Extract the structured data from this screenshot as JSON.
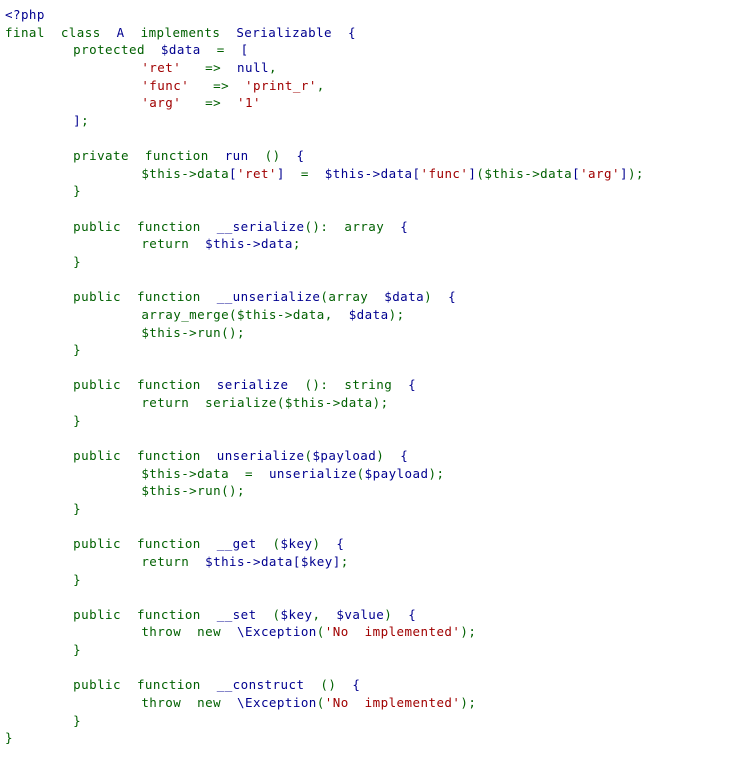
{
  "document": {
    "title": "PHP source code listing",
    "language": "php",
    "background_color": "#ffffff",
    "colors": {
      "keyword_green": "#006000",
      "identifier_blue": "#00008f",
      "string_red": "#a00000"
    },
    "lines": [
      {
        "indent": 0,
        "tokens": [
          {
            "t": "<?php",
            "c": "tag"
          }
        ]
      },
      {
        "indent": 0,
        "tokens": [
          {
            "t": "final  class  ",
            "c": "kw"
          },
          {
            "t": "A",
            "c": "name"
          },
          {
            "t": "  implements  ",
            "c": "kw"
          },
          {
            "t": "Serializable",
            "c": "name"
          },
          {
            "t": "  ",
            "c": "kw"
          },
          {
            "t": "{",
            "c": "bracket"
          }
        ]
      },
      {
        "indent": 8,
        "tokens": [
          {
            "t": "protected  ",
            "c": "kw"
          },
          {
            "t": "$data",
            "c": "var"
          },
          {
            "t": "  =  ",
            "c": "kw"
          },
          {
            "t": "[",
            "c": "bracket"
          }
        ]
      },
      {
        "indent": 16,
        "tokens": [
          {
            "t": "'ret'",
            "c": "str"
          },
          {
            "t": "   => ",
            "c": "arrow"
          },
          {
            "t": " null",
            "c": "const"
          },
          {
            "t": ",",
            "c": "punct"
          }
        ]
      },
      {
        "indent": 16,
        "tokens": [
          {
            "t": "'func'",
            "c": "str"
          },
          {
            "t": "   => ",
            "c": "arrow"
          },
          {
            "t": " ",
            "c": "punct"
          },
          {
            "t": "'print_r'",
            "c": "str"
          },
          {
            "t": ",",
            "c": "punct"
          }
        ]
      },
      {
        "indent": 16,
        "tokens": [
          {
            "t": "'arg'",
            "c": "str"
          },
          {
            "t": "   => ",
            "c": "arrow"
          },
          {
            "t": " ",
            "c": "punct"
          },
          {
            "t": "'1'",
            "c": "str"
          }
        ]
      },
      {
        "indent": 8,
        "tokens": [
          {
            "t": "]",
            "c": "bracket"
          },
          {
            "t": ";",
            "c": "punct"
          }
        ]
      },
      {
        "indent": 0,
        "tokens": []
      },
      {
        "indent": 8,
        "tokens": [
          {
            "t": "private  function  ",
            "c": "kw"
          },
          {
            "t": "run",
            "c": "name"
          },
          {
            "t": "  ()  ",
            "c": "punct"
          },
          {
            "t": "{",
            "c": "bracket"
          }
        ]
      },
      {
        "indent": 16,
        "tokens": [
          {
            "t": "$this->data",
            "c": "kw"
          },
          {
            "t": "[",
            "c": "bracket"
          },
          {
            "t": "'ret'",
            "c": "str"
          },
          {
            "t": "]",
            "c": "bracket"
          },
          {
            "t": "  =  ",
            "c": "punct"
          },
          {
            "t": "$this->data",
            "c": "name"
          },
          {
            "t": "[",
            "c": "bracket"
          },
          {
            "t": "'func'",
            "c": "str"
          },
          {
            "t": "]",
            "c": "bracket"
          },
          {
            "t": "(",
            "c": "punct"
          },
          {
            "t": "$this->data",
            "c": "kw"
          },
          {
            "t": "[",
            "c": "bracket"
          },
          {
            "t": "'arg'",
            "c": "str"
          },
          {
            "t": "]",
            "c": "bracket"
          },
          {
            "t": ");",
            "c": "punct"
          }
        ]
      },
      {
        "indent": 8,
        "tokens": [
          {
            "t": "}",
            "c": "punct"
          }
        ]
      },
      {
        "indent": 0,
        "tokens": []
      },
      {
        "indent": 8,
        "tokens": [
          {
            "t": "public  function  ",
            "c": "kw"
          },
          {
            "t": "__serialize",
            "c": "name"
          },
          {
            "t": "():  ",
            "c": "punct"
          },
          {
            "t": "array",
            "c": "kw"
          },
          {
            "t": "  ",
            "c": "kw"
          },
          {
            "t": "{",
            "c": "bracket"
          }
        ]
      },
      {
        "indent": 16,
        "tokens": [
          {
            "t": "return  ",
            "c": "kw"
          },
          {
            "t": "$this->data",
            "c": "name"
          },
          {
            "t": ";",
            "c": "punct"
          }
        ]
      },
      {
        "indent": 8,
        "tokens": [
          {
            "t": "}",
            "c": "punct"
          }
        ]
      },
      {
        "indent": 0,
        "tokens": []
      },
      {
        "indent": 8,
        "tokens": [
          {
            "t": "public  function  ",
            "c": "kw"
          },
          {
            "t": "__unserialize",
            "c": "name"
          },
          {
            "t": "(",
            "c": "punct"
          },
          {
            "t": "array",
            "c": "kw"
          },
          {
            "t": "  ",
            "c": "kw"
          },
          {
            "t": "$data",
            "c": "var"
          },
          {
            "t": ")  ",
            "c": "punct"
          },
          {
            "t": "{",
            "c": "bracket"
          }
        ]
      },
      {
        "indent": 16,
        "tokens": [
          {
            "t": "array_merge",
            "c": "kw"
          },
          {
            "t": "(",
            "c": "punct"
          },
          {
            "t": "$this->data",
            "c": "kw"
          },
          {
            "t": ",  ",
            "c": "punct"
          },
          {
            "t": "$data",
            "c": "var"
          },
          {
            "t": ");",
            "c": "punct"
          }
        ]
      },
      {
        "indent": 16,
        "tokens": [
          {
            "t": "$this->run",
            "c": "kw"
          },
          {
            "t": "();",
            "c": "punct"
          }
        ]
      },
      {
        "indent": 8,
        "tokens": [
          {
            "t": "}",
            "c": "punct"
          }
        ]
      },
      {
        "indent": 0,
        "tokens": []
      },
      {
        "indent": 8,
        "tokens": [
          {
            "t": "public  function  ",
            "c": "kw"
          },
          {
            "t": "serialize",
            "c": "name"
          },
          {
            "t": "  ():  ",
            "c": "punct"
          },
          {
            "t": "string",
            "c": "kw"
          },
          {
            "t": "  ",
            "c": "kw"
          },
          {
            "t": "{",
            "c": "bracket"
          }
        ]
      },
      {
        "indent": 16,
        "tokens": [
          {
            "t": "return  ",
            "c": "kw"
          },
          {
            "t": "serialize",
            "c": "kw"
          },
          {
            "t": "(",
            "c": "punct"
          },
          {
            "t": "$this->data",
            "c": "kw"
          },
          {
            "t": ");",
            "c": "punct"
          }
        ]
      },
      {
        "indent": 8,
        "tokens": [
          {
            "t": "}",
            "c": "punct"
          }
        ]
      },
      {
        "indent": 0,
        "tokens": []
      },
      {
        "indent": 8,
        "tokens": [
          {
            "t": "public  function  ",
            "c": "kw"
          },
          {
            "t": "unserialize",
            "c": "name"
          },
          {
            "t": "(",
            "c": "punct"
          },
          {
            "t": "$payload",
            "c": "var"
          },
          {
            "t": ")  ",
            "c": "punct"
          },
          {
            "t": "{",
            "c": "bracket"
          }
        ]
      },
      {
        "indent": 16,
        "tokens": [
          {
            "t": "$this->data",
            "c": "kw"
          },
          {
            "t": "  =  ",
            "c": "punct"
          },
          {
            "t": "unserialize",
            "c": "name"
          },
          {
            "t": "(",
            "c": "punct"
          },
          {
            "t": "$payload",
            "c": "var"
          },
          {
            "t": ");",
            "c": "punct"
          }
        ]
      },
      {
        "indent": 16,
        "tokens": [
          {
            "t": "$this->run",
            "c": "kw"
          },
          {
            "t": "();",
            "c": "punct"
          }
        ]
      },
      {
        "indent": 8,
        "tokens": [
          {
            "t": "}",
            "c": "punct"
          }
        ]
      },
      {
        "indent": 0,
        "tokens": []
      },
      {
        "indent": 8,
        "tokens": [
          {
            "t": "public  function  ",
            "c": "kw"
          },
          {
            "t": "__get",
            "c": "name"
          },
          {
            "t": "  (",
            "c": "punct"
          },
          {
            "t": "$key",
            "c": "var"
          },
          {
            "t": ")  ",
            "c": "punct"
          },
          {
            "t": "{",
            "c": "bracket"
          }
        ]
      },
      {
        "indent": 16,
        "tokens": [
          {
            "t": "return  ",
            "c": "kw"
          },
          {
            "t": "$this->data",
            "c": "name"
          },
          {
            "t": "[",
            "c": "bracket"
          },
          {
            "t": "$key",
            "c": "var"
          },
          {
            "t": "]",
            "c": "bracket"
          },
          {
            "t": ";",
            "c": "punct"
          }
        ]
      },
      {
        "indent": 8,
        "tokens": [
          {
            "t": "}",
            "c": "punct"
          }
        ]
      },
      {
        "indent": 0,
        "tokens": []
      },
      {
        "indent": 8,
        "tokens": [
          {
            "t": "public  function  ",
            "c": "kw"
          },
          {
            "t": "__set",
            "c": "name"
          },
          {
            "t": "  (",
            "c": "punct"
          },
          {
            "t": "$key",
            "c": "var"
          },
          {
            "t": ",  ",
            "c": "punct"
          },
          {
            "t": "$value",
            "c": "var"
          },
          {
            "t": ")  ",
            "c": "punct"
          },
          {
            "t": "{",
            "c": "bracket"
          }
        ]
      },
      {
        "indent": 16,
        "tokens": [
          {
            "t": "throw  new  ",
            "c": "kw"
          },
          {
            "t": "\\Exception",
            "c": "name"
          },
          {
            "t": "(",
            "c": "punct"
          },
          {
            "t": "'No  implemented'",
            "c": "str"
          },
          {
            "t": ");",
            "c": "punct"
          }
        ]
      },
      {
        "indent": 8,
        "tokens": [
          {
            "t": "}",
            "c": "punct"
          }
        ]
      },
      {
        "indent": 0,
        "tokens": []
      },
      {
        "indent": 8,
        "tokens": [
          {
            "t": "public  function  ",
            "c": "kw"
          },
          {
            "t": "__construct",
            "c": "name"
          },
          {
            "t": "  ()  ",
            "c": "punct"
          },
          {
            "t": "{",
            "c": "bracket"
          }
        ]
      },
      {
        "indent": 16,
        "tokens": [
          {
            "t": "throw  new  ",
            "c": "kw"
          },
          {
            "t": "\\Exception",
            "c": "name"
          },
          {
            "t": "(",
            "c": "punct"
          },
          {
            "t": "'No  implemented'",
            "c": "str"
          },
          {
            "t": ");",
            "c": "punct"
          }
        ]
      },
      {
        "indent": 8,
        "tokens": [
          {
            "t": "}",
            "c": "punct"
          }
        ]
      },
      {
        "indent": 0,
        "tokens": [
          {
            "t": "}",
            "c": "punct"
          }
        ]
      }
    ]
  }
}
